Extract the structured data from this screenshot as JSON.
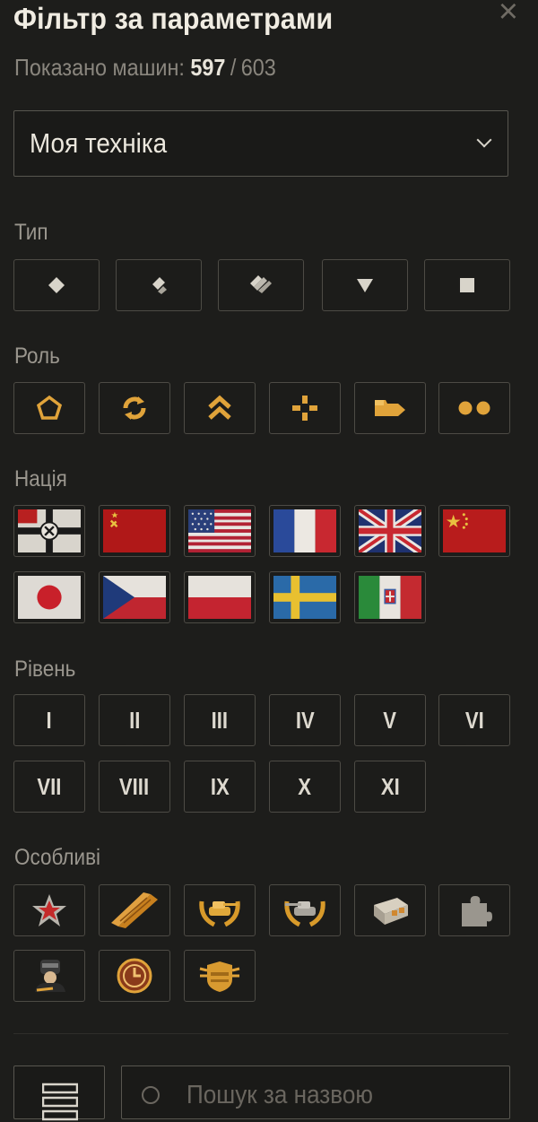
{
  "header": {
    "title": "Фільтр за параметрами",
    "count_label": "Показано машин:",
    "count_shown": "597",
    "count_separator": "/",
    "count_total": "603"
  },
  "dropdown": {
    "value": "Моя техніка"
  },
  "sections": {
    "type": "Тип",
    "role": "Роль",
    "nation": "Нація",
    "tier": "Рівень",
    "special": "Особливі"
  },
  "type_icons": [
    "light-tank-icon",
    "medium-tank-icon",
    "heavy-tank-icon",
    "tank-destroyer-icon",
    "spg-icon"
  ],
  "role_icons": [
    "pentagon-role-icon",
    "cycle-role-icon",
    "chevron-up-role-icon",
    "crosshair-role-icon",
    "sniper-role-icon",
    "support-role-icon"
  ],
  "nations": [
    "Germany",
    "USSR",
    "USA",
    "France",
    "UK",
    "China",
    "Japan",
    "Czechoslovakia",
    "Poland",
    "Sweden",
    "Italy"
  ],
  "tiers": [
    "I",
    "II",
    "III",
    "IV",
    "V",
    "VI",
    "VII",
    "VIII",
    "IX",
    "X",
    "XI"
  ],
  "special_icons": [
    "collector-star-icon",
    "premium-stripe-icon",
    "elite-wreath-icon",
    "premium-wreath-icon",
    "rental-box-icon",
    "puzzle-icon",
    "crew-icon",
    "timer-icon",
    "shield-badge-icon"
  ],
  "search": {
    "placeholder": "Пошук за назвою"
  },
  "colors": {
    "accent": "#e0a33a",
    "bg": "#1d1d1b",
    "border": "#4d4b45"
  }
}
